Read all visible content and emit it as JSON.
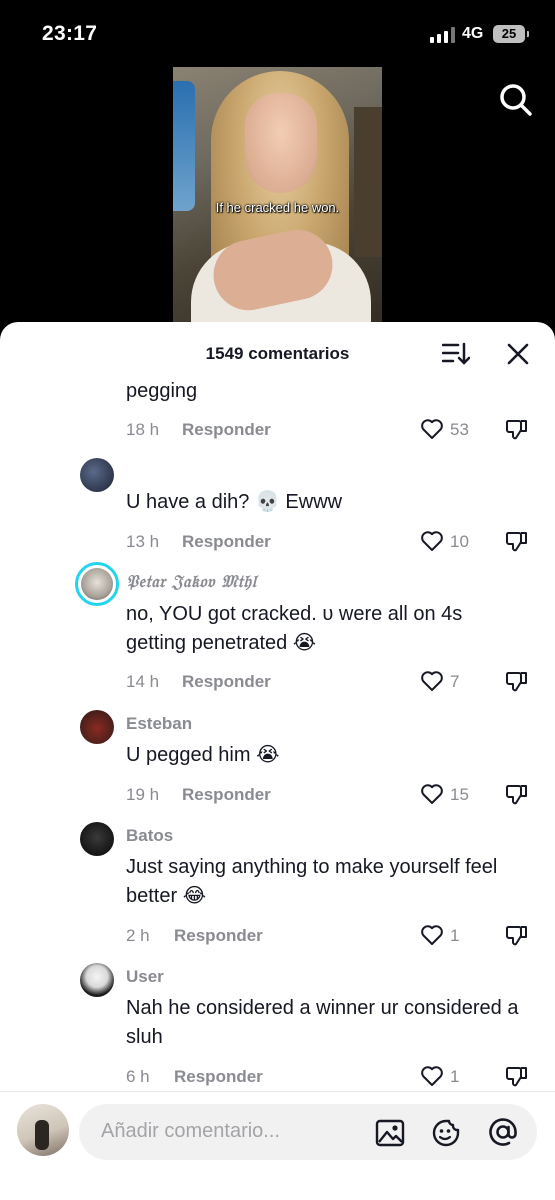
{
  "status_bar": {
    "time": "23:17",
    "network": "4G",
    "battery": "25"
  },
  "video": {
    "caption": "If he cracked he won."
  },
  "comments_panel": {
    "title": "1549 comentarios",
    "comments": [
      {
        "username": "",
        "text": "pegging",
        "time": "18 h",
        "reply_label": "Responder",
        "likes": "53"
      },
      {
        "username": "",
        "text": "U have a dih? 💀 Ewww",
        "time": "13 h",
        "reply_label": "Responder",
        "likes": "10"
      },
      {
        "username": "𝔓𝔢𝔱𝔞𝔯 𝔍𝔞𝔨𝔬𝔳 𝔐𝔱𝔥𝔩",
        "text": "no, YOU got cracked. ᴜ were all on 4s getting penetrated 😭",
        "time": "14 h",
        "reply_label": "Responder",
        "likes": "7"
      },
      {
        "username": "Esteban",
        "text": "U pegged him 😭",
        "time": "19 h",
        "reply_label": "Responder",
        "likes": "15"
      },
      {
        "username": "Batos",
        "text": "Just saying anything to make yourself feel better 😂",
        "time": "2 h",
        "reply_label": "Responder",
        "likes": "1"
      },
      {
        "username": "User",
        "text": "Nah he considered a winner ur considered a sluh",
        "time": "6 h",
        "reply_label": "Responder",
        "likes": "1"
      }
    ]
  },
  "composer": {
    "placeholder": "Añadir comentario..."
  },
  "colors": {
    "text_primary": "#161823",
    "text_secondary": "#8a8b91",
    "story_ring": "#20d5ec"
  }
}
